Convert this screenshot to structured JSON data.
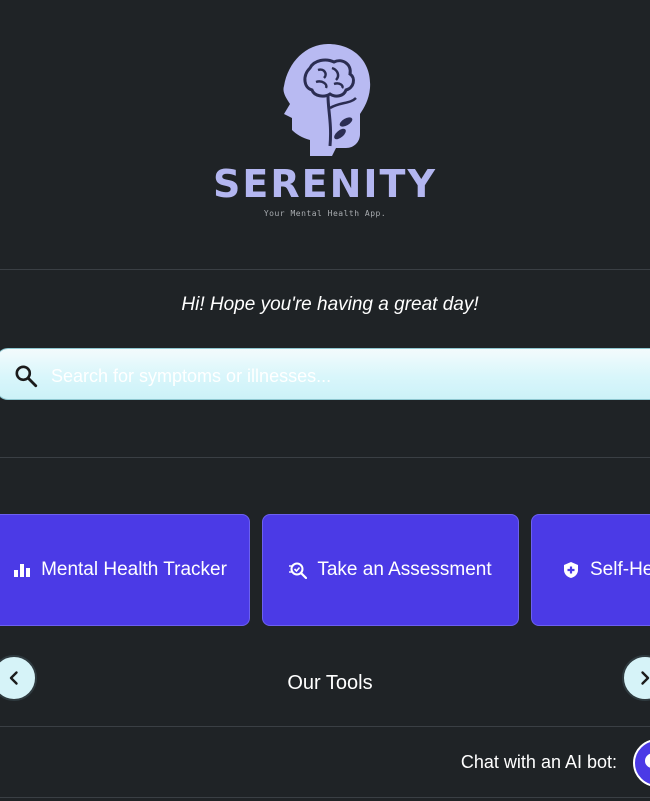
{
  "header": {
    "brand": "SERENITY",
    "tagline": "Your Mental Health App."
  },
  "greeting": "Hi! Hope you're having a great day!",
  "search": {
    "placeholder": "Search for symptoms or illnesses..."
  },
  "tools": {
    "title": "Our Tools",
    "cards": [
      {
        "label": "Mental Health Tracker",
        "icon": "bar-chart-icon"
      },
      {
        "label": "Take an Assessment",
        "icon": "magnifier-check-icon"
      },
      {
        "label": "Self-He",
        "icon": "shield-icon"
      }
    ]
  },
  "chat": {
    "label": "Chat with an AI bot:"
  },
  "colors": {
    "background": "#1f2326",
    "brand": "#b3b6f0",
    "card": "#4b3ae6",
    "search": "#d9f6fb"
  }
}
